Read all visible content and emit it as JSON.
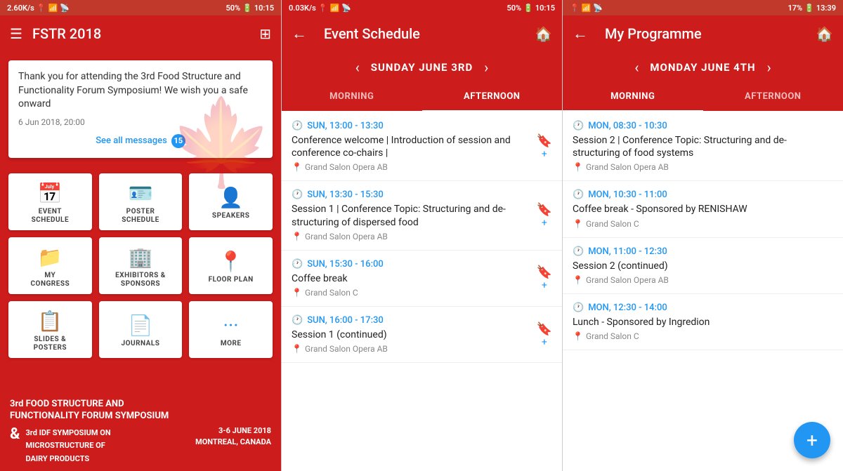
{
  "panel1": {
    "statusBar": {
      "speed": "2.60K/s",
      "battery": "50%",
      "time": "10:15"
    },
    "appBar": {
      "title": "FSTR 2018",
      "menuIcon": "☰",
      "gridIcon": "⊞"
    },
    "message": {
      "text": "Thank you for attending the 3rd Food Structure and Functionality Forum Symposium! We wish you a safe onward",
      "date": "6 Jun 2018, 20:00",
      "seeAll": "See all messages",
      "badgeCount": "15"
    },
    "gridButtons": [
      {
        "id": "event-schedule",
        "label": "EVENT\nSCHEDULE",
        "icon": "📅"
      },
      {
        "id": "poster-schedule",
        "label": "POSTER\nSCHEDULE",
        "icon": "🪪"
      },
      {
        "id": "speakers",
        "label": "SPEAKERS",
        "icon": "👤"
      },
      {
        "id": "my-congress",
        "label": "MY\nCONGRESS",
        "icon": "📁"
      },
      {
        "id": "exhibitors-sponsors",
        "label": "EXHIBITORS &\nSPONSORS",
        "icon": "🏢"
      },
      {
        "id": "floor-plan",
        "label": "FLOOR PLAN",
        "icon": "📍"
      },
      {
        "id": "slides-posters",
        "label": "SLIDES &\nPOSTERS",
        "icon": "📋"
      },
      {
        "id": "journals",
        "label": "JOURNALS",
        "icon": "📄"
      },
      {
        "id": "more",
        "label": "MORE",
        "icon": "···"
      }
    ],
    "footer": {
      "line1": "3rd FOOD STRUCTURE AND",
      "line2": "FUNCTIONALITY FORUM SYMPOSIUM",
      "ampersand": "&",
      "line3": "3rd IDF SYMPOSIUM ON",
      "line4": "MICROSTRUCTURE OF",
      "line5": "DAIRY PRODUCTS",
      "dateRange": "3-6 JUNE 2018",
      "location": "MONTREAL, CANADA"
    }
  },
  "panel2": {
    "statusBar": {
      "speed": "0.03K/s",
      "battery": "50%",
      "time": "10:15"
    },
    "appBar": {
      "title": "Event Schedule",
      "backIcon": "←",
      "homeIcon": "🏠"
    },
    "dateNav": {
      "date": "SUNDAY JUNE 3RD",
      "prevIcon": "‹",
      "nextIcon": "›"
    },
    "tabs": [
      {
        "id": "morning",
        "label": "MORNING",
        "active": false
      },
      {
        "id": "afternoon",
        "label": "AFTERNOON",
        "active": true
      }
    ],
    "events": [
      {
        "time": "SUN, 13:00 - 13:30",
        "title": "Conference welcome | Introduction of session and conference co-chairs |",
        "location": "Grand Salon Opera AB",
        "hasAdd": true
      },
      {
        "time": "SUN, 13:30 - 15:30",
        "title": "Session 1 | Conference Topic: Structuring and de-structuring of dispersed food",
        "location": "Grand Salon Opera AB",
        "hasAdd": true
      },
      {
        "time": "SUN, 15:30 - 16:00",
        "title": "Coffee break",
        "location": "Grand Salon C",
        "hasAdd": true
      },
      {
        "time": "SUN, 16:00 - 17:30",
        "title": "Session 1 (continued)",
        "location": "Grand Salon Opera AB",
        "hasAdd": true
      }
    ]
  },
  "panel3": {
    "statusBar": {
      "battery": "17%",
      "time": "13:39"
    },
    "appBar": {
      "title": "My Programme",
      "backIcon": "←",
      "homeIcon": "🏠"
    },
    "dateNav": {
      "date": "MONDAY JUNE 4TH",
      "prevIcon": "‹",
      "nextIcon": "›"
    },
    "tabs": [
      {
        "id": "morning",
        "label": "MORNING",
        "active": true
      },
      {
        "id": "afternoon",
        "label": "AFTERNOON",
        "active": false
      }
    ],
    "events": [
      {
        "time": "MON, 08:30 - 10:30",
        "title": "Session 2 | Conference Topic: Structuring and de-structuring of food systems",
        "location": "Grand Salon Opera AB",
        "hasAdd": false
      },
      {
        "time": "MON, 10:30 - 11:00",
        "title": "Coffee break - Sponsored by RENISHAW",
        "location": "Grand Salon C",
        "hasAdd": false
      },
      {
        "time": "MON, 11:00 - 12:30",
        "title": "Session 2 (continued)",
        "location": "Grand Salon Opera AB",
        "hasAdd": false
      },
      {
        "time": "MON, 12:30 - 14:00",
        "title": "Lunch - Sponsored by Ingredion",
        "location": "Grand Salon C",
        "hasAdd": false
      }
    ],
    "fab": "+"
  }
}
